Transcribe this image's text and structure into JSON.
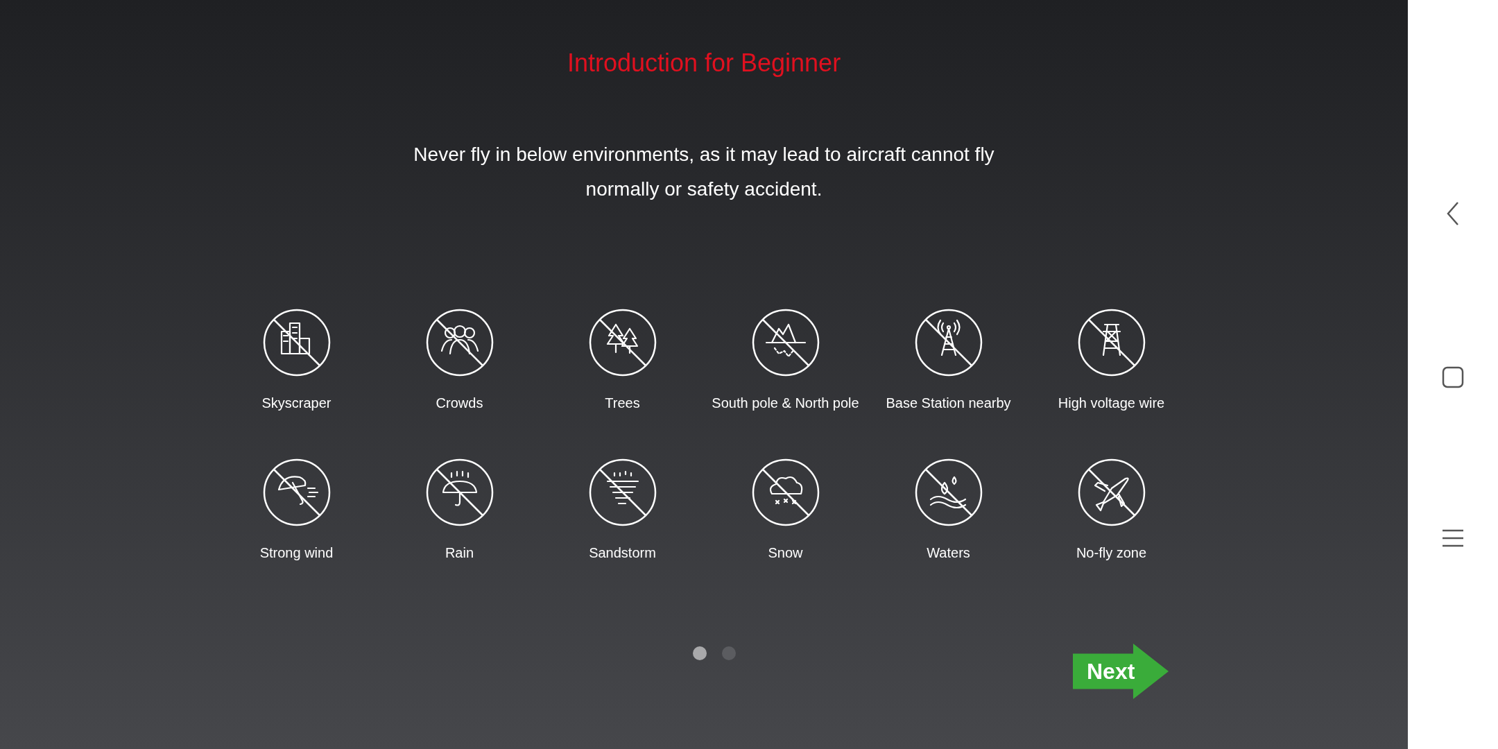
{
  "title": "Introduction for Beginner",
  "description": "Never fly in below environments, as it may lead to aircraft cannot fly normally or safety accident.",
  "environments": [
    {
      "label": "Skyscraper"
    },
    {
      "label": "Crowds"
    },
    {
      "label": "Trees"
    },
    {
      "label": "South pole & North pole"
    },
    {
      "label": "Base Station nearby"
    },
    {
      "label": "High voltage wire"
    },
    {
      "label": "Strong wind"
    },
    {
      "label": "Rain"
    },
    {
      "label": "Sandstorm"
    },
    {
      "label": "Snow"
    },
    {
      "label": "Waters"
    },
    {
      "label": "No-fly zone"
    }
  ],
  "pager": [
    {
      "selected": true
    },
    {
      "selected": false
    }
  ],
  "next_button": "Next"
}
